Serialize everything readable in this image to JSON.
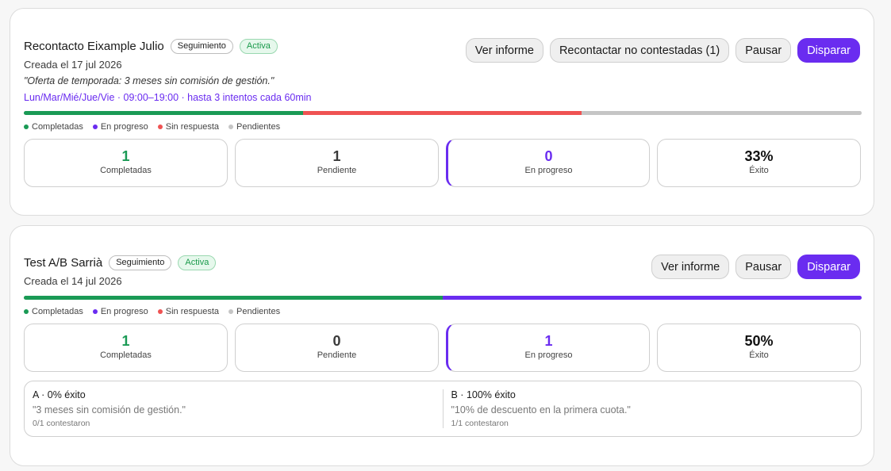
{
  "campaigns": [
    {
      "title": "Recontacto Eixample Julio",
      "type_badge": "Seguimiento",
      "status_badge": "Activa",
      "created": "Creada el 17 jul 2026",
      "quote": "\"Oferta de temporada: 3 meses sin comisión de gestión.\"",
      "schedule": "Lun/Mar/Mié/Jue/Vie · 09:00–19:00 · hasta 3 intentos cada 60min",
      "buttons": {
        "report": "Ver informe",
        "recontact": "Recontactar no contestadas (1)",
        "pause": "Pausar",
        "fire": "Disparar"
      },
      "progress": {
        "completed_fraction": 0.333,
        "in_progress_fraction": 0,
        "no_answer_fraction": 0.333,
        "pending_fraction": 0.334
      },
      "legend": [
        "Completadas",
        "En progreso",
        "Sin respuesta",
        "Pendientes"
      ],
      "stats": [
        {
          "value": "1",
          "label": "Completadas"
        },
        {
          "value": "1",
          "label": "Pendiente"
        },
        {
          "value": "0",
          "label": "En progreso"
        },
        {
          "value": "33%",
          "label": "Éxito"
        }
      ]
    },
    {
      "title": "Test A/B Sarrià",
      "type_badge": "Seguimiento",
      "status_badge": "Activa",
      "created": "Creada el 14 jul 2026",
      "buttons": {
        "report": "Ver informe",
        "pause": "Pausar",
        "fire": "Disparar"
      },
      "progress": {
        "completed_fraction": 0.5,
        "in_progress_fraction": 0.5,
        "no_answer_fraction": 0,
        "pending_fraction": 0
      },
      "legend": [
        "Completadas",
        "En progreso",
        "Sin respuesta",
        "Pendientes"
      ],
      "stats": [
        {
          "value": "1",
          "label": "Completadas"
        },
        {
          "value": "0",
          "label": "Pendiente"
        },
        {
          "value": "1",
          "label": "En progreso"
        },
        {
          "value": "50%",
          "label": "Éxito"
        }
      ],
      "ab_test": [
        {
          "title": "A · 0% éxito",
          "message": "\"3 meses sin comisión de gestión.\"",
          "responses": "0/1 contestaron"
        },
        {
          "title": "B · 100% éxito",
          "message": "\"10% de descuento en la primera cuota.\"",
          "responses": "1/1 contestaron"
        }
      ]
    }
  ],
  "colors": {
    "accent": "#6a2cf0",
    "completed": "#1a9a55",
    "no_answer": "#ef5353",
    "pending": "#c5c5c5"
  }
}
